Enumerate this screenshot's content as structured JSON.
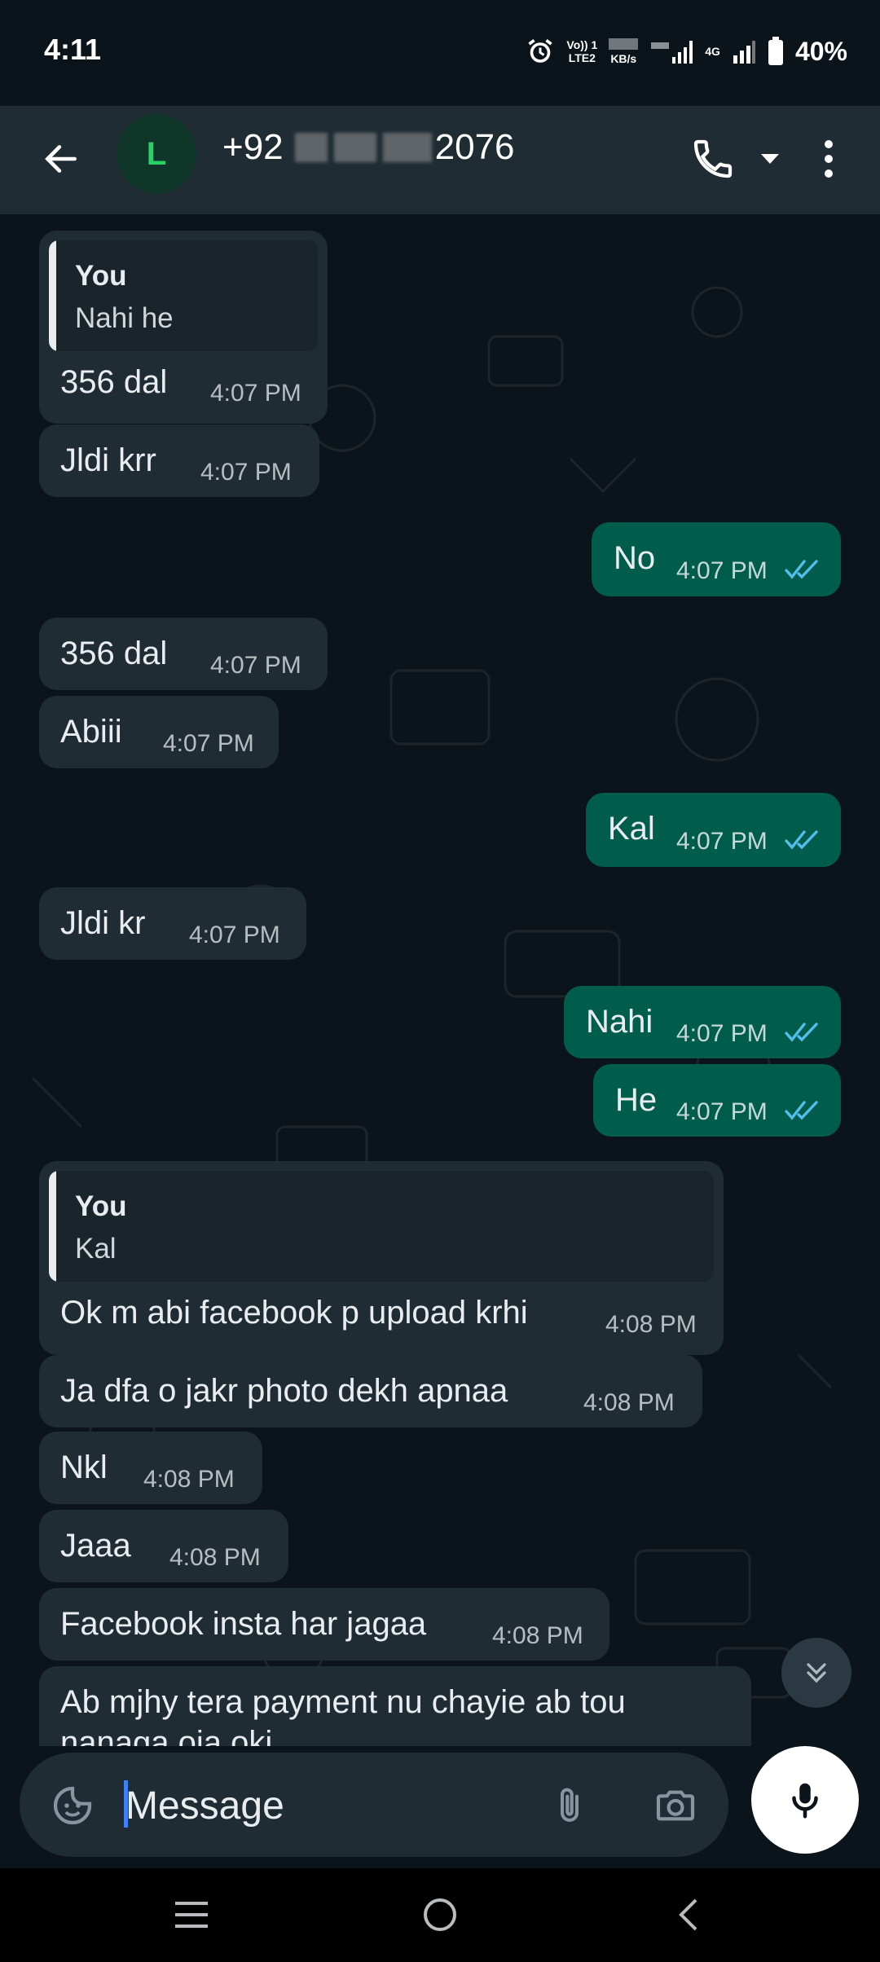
{
  "status_bar": {
    "time": "4:11",
    "volte": "Vo)) 1",
    "lte": "LTE2",
    "kbs": "KB/s",
    "net": "4G",
    "battery": "40%"
  },
  "app_bar": {
    "avatar_letter": "L",
    "contact_prefix": "+92",
    "contact_suffix": "2076"
  },
  "messages": [
    {
      "dir": "in",
      "quote_who": "You",
      "quote_text": "Nahi he",
      "text": "356 dal",
      "time": "4:07 PM"
    },
    {
      "dir": "in",
      "text": "Jldi krr",
      "time": "4:07 PM"
    },
    {
      "dir": "out",
      "text": "No",
      "time": "4:07 PM"
    },
    {
      "dir": "in",
      "text": "356 dal",
      "time": "4:07 PM"
    },
    {
      "dir": "in",
      "text": "Abiii",
      "time": "4:07 PM"
    },
    {
      "dir": "out",
      "text": "Kal",
      "time": "4:07 PM"
    },
    {
      "dir": "in",
      "text": "Jldi kr",
      "time": "4:07 PM"
    },
    {
      "dir": "out",
      "text": "Nahi",
      "time": "4:07 PM"
    },
    {
      "dir": "out",
      "text": "He",
      "time": "4:07 PM"
    },
    {
      "dir": "in",
      "quote_who": "You",
      "quote_text": "Kal",
      "text": "Ok m abi facebook p upload krhi",
      "time": "4:08 PM"
    },
    {
      "dir": "in",
      "text": "Ja dfa o jakr photo dekh apnaa",
      "time": "4:08 PM"
    },
    {
      "dir": "in",
      "text": "Nkl",
      "time": "4:08 PM"
    },
    {
      "dir": "in",
      "text": "Jaaa",
      "time": "4:08 PM"
    },
    {
      "dir": "in",
      "text": "Facebook insta har jagaa",
      "time": "4:08 PM"
    },
    {
      "dir": "in",
      "text": "Ab mjhy tera payment nu chayie ab tou",
      "text2": "nanaga oja oki",
      "time": ""
    }
  ],
  "composer": {
    "placeholder": "Message"
  },
  "colors": {
    "background": "#0b141a",
    "incoming_bubble": "#1f2c34",
    "outgoing_bubble": "#005c4b",
    "read_ticks": "#53bdeb"
  }
}
